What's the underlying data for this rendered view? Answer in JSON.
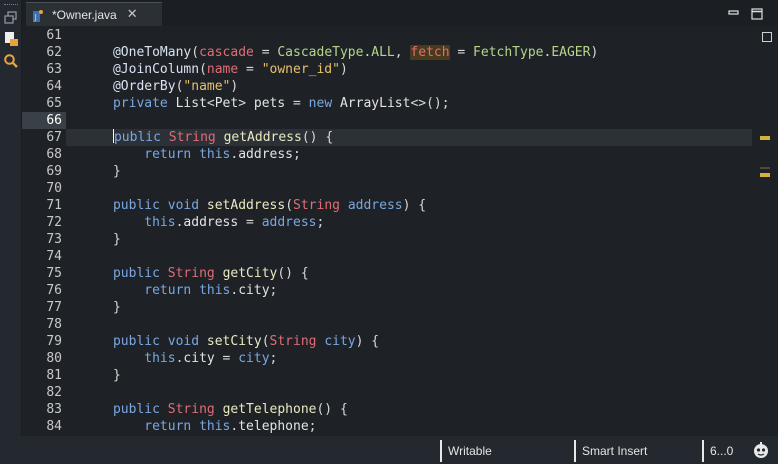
{
  "tab": {
    "title": "*Owner.java",
    "close_glyph": "✕"
  },
  "left_bar": {
    "icons": [
      "restore-icon",
      "package-explorer-icon",
      "search-icon"
    ]
  },
  "editor": {
    "line_numbers": [
      "61",
      "62",
      "63",
      "64",
      "65",
      "66",
      "67",
      "68",
      "69",
      "70",
      "71",
      "72",
      "73",
      "74",
      "75",
      "76",
      "77",
      "78",
      "79",
      "80",
      "81",
      "82",
      "83",
      "84"
    ],
    "current_line": "66",
    "lines": [
      "",
      "    @OneToMany(cascade = CascadeType.ALL, fetch = FetchType.EAGER)",
      "    @JoinColumn(name = \"owner_id\")",
      "    @OrderBy(\"name\")",
      "    private List<Pet> pets = new ArrayList<>();",
      "",
      "    public String getAddress() {",
      "        return this.address;",
      "    }",
      "",
      "    public void setAddress(String address) {",
      "        this.address = address;",
      "    }",
      "",
      "    public String getCity() {",
      "        return this.city;",
      "    }",
      "",
      "    public void setCity(String city) {",
      "        this.city = city;",
      "    }",
      "",
      "    public String getTelephone() {",
      "        return this.telephone;"
    ]
  },
  "colors": {
    "annotation": "#d9e2f2",
    "parameter": "#e06c75",
    "enum_constant": "#b6d58a",
    "string": "#e7c06b",
    "keyword": "#7aa7e0",
    "overview_marker": "#d4b23a"
  },
  "status_bar": {
    "writable": "Writable",
    "insert_mode": "Smart Insert",
    "position": "6...0"
  }
}
